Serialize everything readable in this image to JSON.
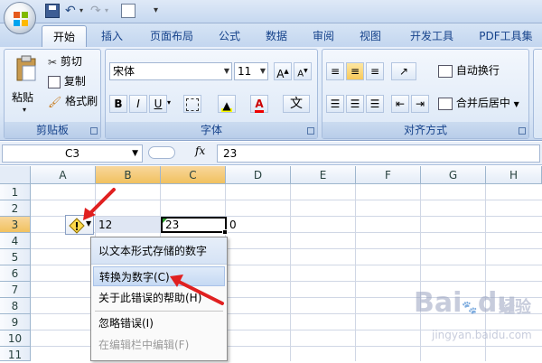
{
  "tabs": [
    "开始",
    "插入",
    "页面布局",
    "公式",
    "数据",
    "审阅",
    "视图",
    "开发工具",
    "PDF工具集"
  ],
  "clipboard": {
    "paste": "粘贴",
    "cut": "剪切",
    "copy": "复制",
    "format_painter": "格式刷",
    "label": "剪贴板"
  },
  "font": {
    "name": "宋体",
    "size": "11",
    "label": "字体",
    "grow": "A",
    "shrink": "A",
    "bold": "B",
    "italic": "I",
    "underline": "U",
    "wen": "文"
  },
  "alignment": {
    "wrap": "自动换行",
    "merge": "合并后居中",
    "label": "对齐方式"
  },
  "formula_bar": {
    "name_box": "C3",
    "fx": "fx",
    "content": "23"
  },
  "columns": [
    "A",
    "B",
    "C",
    "D",
    "E",
    "F",
    "G",
    "H"
  ],
  "rows": [
    "1",
    "2",
    "3",
    "4",
    "5",
    "6",
    "7",
    "8",
    "9",
    "10",
    "11"
  ],
  "cells": {
    "b3": "12",
    "c3": "23",
    "d3": "0"
  },
  "context_menu": {
    "header": "以文本形式存储的数字",
    "items": [
      "转换为数字(C)",
      "关于此错误的帮助(H)",
      "忽略错误(I)",
      "在编辑栏中编辑(F)"
    ]
  },
  "watermark": {
    "brand": "Bai",
    "logo_char": "du",
    "suffix": "经验",
    "url": "jingyan.baidu.com"
  },
  "colors": {
    "accent": "#15428b",
    "arrow": "#e02020",
    "selection_header": "#f1c15f"
  }
}
